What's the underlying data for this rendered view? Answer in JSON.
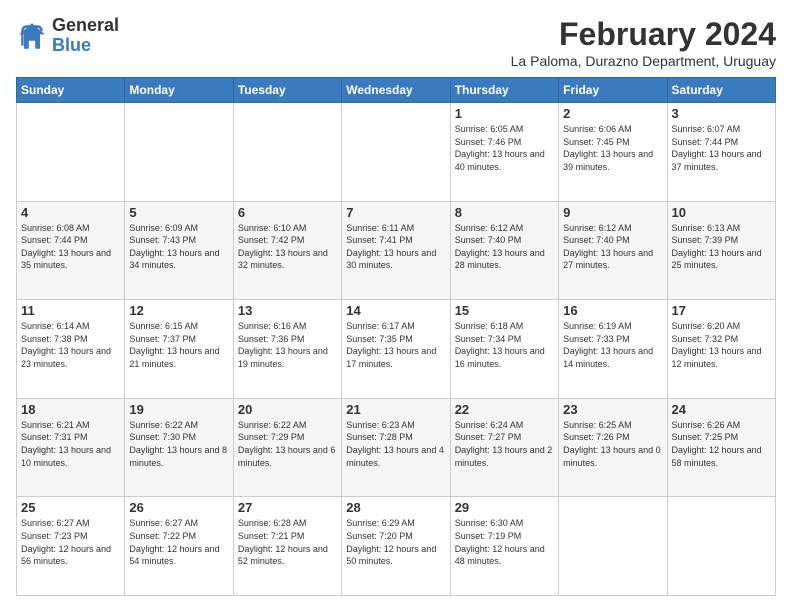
{
  "header": {
    "logo_general": "General",
    "logo_blue": "Blue",
    "month_title": "February 2024",
    "location": "La Paloma, Durazno Department, Uruguay"
  },
  "days_of_week": [
    "Sunday",
    "Monday",
    "Tuesday",
    "Wednesday",
    "Thursday",
    "Friday",
    "Saturday"
  ],
  "weeks": [
    [
      {
        "day": "",
        "info": ""
      },
      {
        "day": "",
        "info": ""
      },
      {
        "day": "",
        "info": ""
      },
      {
        "day": "",
        "info": ""
      },
      {
        "day": "1",
        "info": "Sunrise: 6:05 AM\nSunset: 7:46 PM\nDaylight: 13 hours\nand 40 minutes."
      },
      {
        "day": "2",
        "info": "Sunrise: 6:06 AM\nSunset: 7:45 PM\nDaylight: 13 hours\nand 39 minutes."
      },
      {
        "day": "3",
        "info": "Sunrise: 6:07 AM\nSunset: 7:44 PM\nDaylight: 13 hours\nand 37 minutes."
      }
    ],
    [
      {
        "day": "4",
        "info": "Sunrise: 6:08 AM\nSunset: 7:44 PM\nDaylight: 13 hours\nand 35 minutes."
      },
      {
        "day": "5",
        "info": "Sunrise: 6:09 AM\nSunset: 7:43 PM\nDaylight: 13 hours\nand 34 minutes."
      },
      {
        "day": "6",
        "info": "Sunrise: 6:10 AM\nSunset: 7:42 PM\nDaylight: 13 hours\nand 32 minutes."
      },
      {
        "day": "7",
        "info": "Sunrise: 6:11 AM\nSunset: 7:41 PM\nDaylight: 13 hours\nand 30 minutes."
      },
      {
        "day": "8",
        "info": "Sunrise: 6:12 AM\nSunset: 7:40 PM\nDaylight: 13 hours\nand 28 minutes."
      },
      {
        "day": "9",
        "info": "Sunrise: 6:12 AM\nSunset: 7:40 PM\nDaylight: 13 hours\nand 27 minutes."
      },
      {
        "day": "10",
        "info": "Sunrise: 6:13 AM\nSunset: 7:39 PM\nDaylight: 13 hours\nand 25 minutes."
      }
    ],
    [
      {
        "day": "11",
        "info": "Sunrise: 6:14 AM\nSunset: 7:38 PM\nDaylight: 13 hours\nand 23 minutes."
      },
      {
        "day": "12",
        "info": "Sunrise: 6:15 AM\nSunset: 7:37 PM\nDaylight: 13 hours\nand 21 minutes."
      },
      {
        "day": "13",
        "info": "Sunrise: 6:16 AM\nSunset: 7:36 PM\nDaylight: 13 hours\nand 19 minutes."
      },
      {
        "day": "14",
        "info": "Sunrise: 6:17 AM\nSunset: 7:35 PM\nDaylight: 13 hours\nand 17 minutes."
      },
      {
        "day": "15",
        "info": "Sunrise: 6:18 AM\nSunset: 7:34 PM\nDaylight: 13 hours\nand 16 minutes."
      },
      {
        "day": "16",
        "info": "Sunrise: 6:19 AM\nSunset: 7:33 PM\nDaylight: 13 hours\nand 14 minutes."
      },
      {
        "day": "17",
        "info": "Sunrise: 6:20 AM\nSunset: 7:32 PM\nDaylight: 13 hours\nand 12 minutes."
      }
    ],
    [
      {
        "day": "18",
        "info": "Sunrise: 6:21 AM\nSunset: 7:31 PM\nDaylight: 13 hours\nand 10 minutes."
      },
      {
        "day": "19",
        "info": "Sunrise: 6:22 AM\nSunset: 7:30 PM\nDaylight: 13 hours\nand 8 minutes."
      },
      {
        "day": "20",
        "info": "Sunrise: 6:22 AM\nSunset: 7:29 PM\nDaylight: 13 hours\nand 6 minutes."
      },
      {
        "day": "21",
        "info": "Sunrise: 6:23 AM\nSunset: 7:28 PM\nDaylight: 13 hours\nand 4 minutes."
      },
      {
        "day": "22",
        "info": "Sunrise: 6:24 AM\nSunset: 7:27 PM\nDaylight: 13 hours\nand 2 minutes."
      },
      {
        "day": "23",
        "info": "Sunrise: 6:25 AM\nSunset: 7:26 PM\nDaylight: 13 hours\nand 0 minutes."
      },
      {
        "day": "24",
        "info": "Sunrise: 6:26 AM\nSunset: 7:25 PM\nDaylight: 12 hours\nand 58 minutes."
      }
    ],
    [
      {
        "day": "25",
        "info": "Sunrise: 6:27 AM\nSunset: 7:23 PM\nDaylight: 12 hours\nand 56 minutes."
      },
      {
        "day": "26",
        "info": "Sunrise: 6:27 AM\nSunset: 7:22 PM\nDaylight: 12 hours\nand 54 minutes."
      },
      {
        "day": "27",
        "info": "Sunrise: 6:28 AM\nSunset: 7:21 PM\nDaylight: 12 hours\nand 52 minutes."
      },
      {
        "day": "28",
        "info": "Sunrise: 6:29 AM\nSunset: 7:20 PM\nDaylight: 12 hours\nand 50 minutes."
      },
      {
        "day": "29",
        "info": "Sunrise: 6:30 AM\nSunset: 7:19 PM\nDaylight: 12 hours\nand 48 minutes."
      },
      {
        "day": "",
        "info": ""
      },
      {
        "day": "",
        "info": ""
      }
    ]
  ]
}
